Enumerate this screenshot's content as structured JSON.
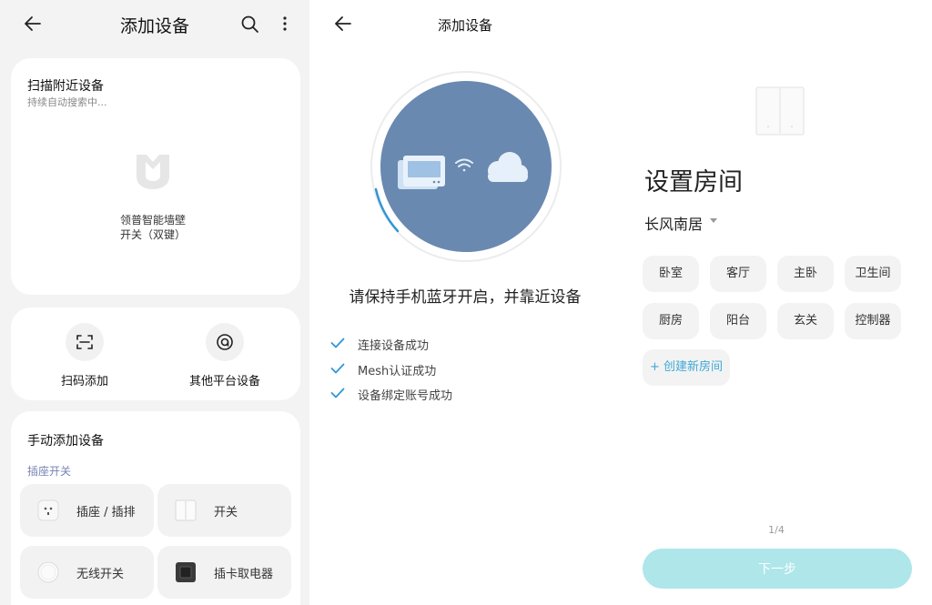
{
  "panel_scan": {
    "title": "添加设备",
    "scan_card": {
      "title": "扫描附近设备",
      "subtitle": "持续自动搜索中...",
      "device_name": "领普智能墙壁开关（双键）"
    },
    "quick_actions": [
      {
        "label": "扫码添加",
        "icon": "scan-icon"
      },
      {
        "label": "其他平台设备",
        "icon": "platform-icon"
      }
    ],
    "manual": {
      "title": "手动添加设备",
      "category": "插座开关",
      "items": [
        {
          "label": "插座 / 插排",
          "icon": "socket-icon"
        },
        {
          "label": "开关",
          "icon": "switch-icon"
        },
        {
          "label": "无线开关",
          "icon": "wireless-switch-icon"
        },
        {
          "label": "插卡取电器",
          "icon": "card-power-icon"
        }
      ]
    }
  },
  "panel_connect": {
    "title": "添加设备",
    "message": "请保持手机蓝牙开启，并靠近设备",
    "steps": [
      {
        "label": "连接设备成功",
        "done": true
      },
      {
        "label": "Mesh认证成功",
        "done": true
      },
      {
        "label": "设备绑定账号成功",
        "done": true
      }
    ],
    "colors": {
      "circle": "#6a89b0",
      "check": "#2f97d6"
    }
  },
  "panel_room": {
    "heading": "设置房间",
    "home": "长风南居",
    "rooms": [
      "卧室",
      "客厅",
      "主卧",
      "卫生间",
      "厨房",
      "阳台",
      "玄关",
      "控制器"
    ],
    "create_room": "+ 创建新房间",
    "pager": "1/4",
    "next_label": "下一步",
    "colors": {
      "next_button": "#aee6ea",
      "link": "#3fa9d5"
    }
  }
}
